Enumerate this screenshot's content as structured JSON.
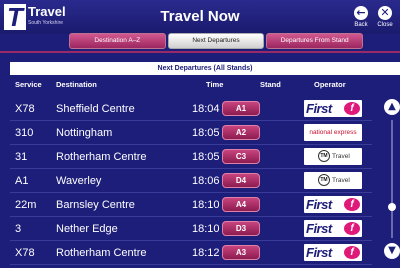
{
  "header": {
    "logo_letter": "T",
    "logo_word": "Travel",
    "logo_sub": "South Yorkshire",
    "title": "Travel Now",
    "back_label": "Back",
    "close_label": "Close",
    "back_icon": "back-arrow-icon",
    "close_icon": "close-x-icon"
  },
  "tabs": [
    {
      "label": "Destination A–Z",
      "active": false
    },
    {
      "label": "Next Departures",
      "active": true
    },
    {
      "label": "Departures From Stand",
      "active": false
    }
  ],
  "board": {
    "subtitle": "Next Departures (All Stands)",
    "columns": {
      "service": "Service",
      "destination": "Destination",
      "time": "Time",
      "stand": "Stand",
      "operator": "Operator"
    },
    "rows": [
      {
        "service": "X78",
        "destination": "Sheffield Centre",
        "time": "18:04",
        "stand": "A1",
        "operator": "first"
      },
      {
        "service": "310",
        "destination": "Nottingham",
        "time": "18:05",
        "stand": "A2",
        "operator": "national"
      },
      {
        "service": "31",
        "destination": "Rotherham Centre",
        "time": "18:05",
        "stand": "C3",
        "operator": "tm"
      },
      {
        "service": "A1",
        "destination": "Waverley",
        "time": "18:06",
        "stand": "D4",
        "operator": "tm"
      },
      {
        "service": "22m",
        "destination": "Barnsley Centre",
        "time": "18:10",
        "stand": "A4",
        "operator": "first"
      },
      {
        "service": "3",
        "destination": "Nether Edge",
        "time": "18:10",
        "stand": "D3",
        "operator": "first"
      },
      {
        "service": "X78",
        "destination": "Rotherham Centre",
        "time": "18:12",
        "stand": "A3",
        "operator": "first"
      }
    ]
  },
  "operators": {
    "first": {
      "text": "First",
      "mark": "f"
    },
    "national": {
      "text": "national express"
    },
    "tm": {
      "mark": "TM",
      "text": "Travel"
    }
  },
  "scroll": {
    "up_icon": "arrow-up-icon",
    "down_icon": "arrow-down-icon",
    "position": 0.75
  },
  "colors": {
    "background": "#1d1d7a",
    "accent": "#9c2660",
    "stand_badge": "#b0306a"
  }
}
